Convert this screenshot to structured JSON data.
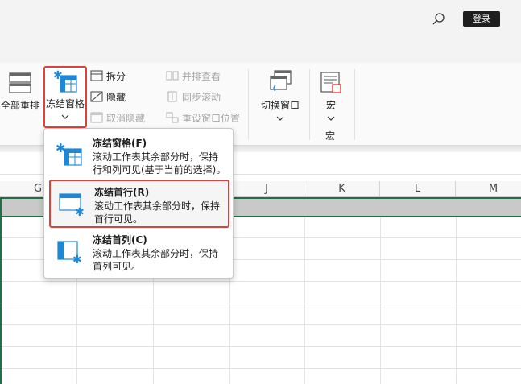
{
  "header": {
    "login_label": "登录",
    "search_icon": "search-icon"
  },
  "ribbon": {
    "arrange_all": "全部重排",
    "freeze_panes": "冻结窗格",
    "split": "拆分",
    "hide": "隐藏",
    "unhide": "取消隐藏",
    "side_by_side": "并排查看",
    "sync_scroll": "同步滚动",
    "reset_position": "重设窗口位置",
    "switch_windows": "切换窗口",
    "macro": "宏",
    "macro_group": "宏"
  },
  "columns": [
    "G",
    "J",
    "K",
    "L",
    "M"
  ],
  "menu": {
    "items": [
      {
        "title": "冻结窗格(F)",
        "desc": "滚动工作表其余部分时，保持行和列可见(基于当前的选择)。"
      },
      {
        "title": "冻结首行(R)",
        "desc": "滚动工作表其余部分时，保持首行可见。"
      },
      {
        "title": "冻结首列(C)",
        "desc": "滚动工作表其余部分时，保持首列可见。"
      }
    ]
  },
  "colors": {
    "accent_red": "#e0403c",
    "excel_green": "#1e7145",
    "icon_blue": "#1e88d8"
  }
}
